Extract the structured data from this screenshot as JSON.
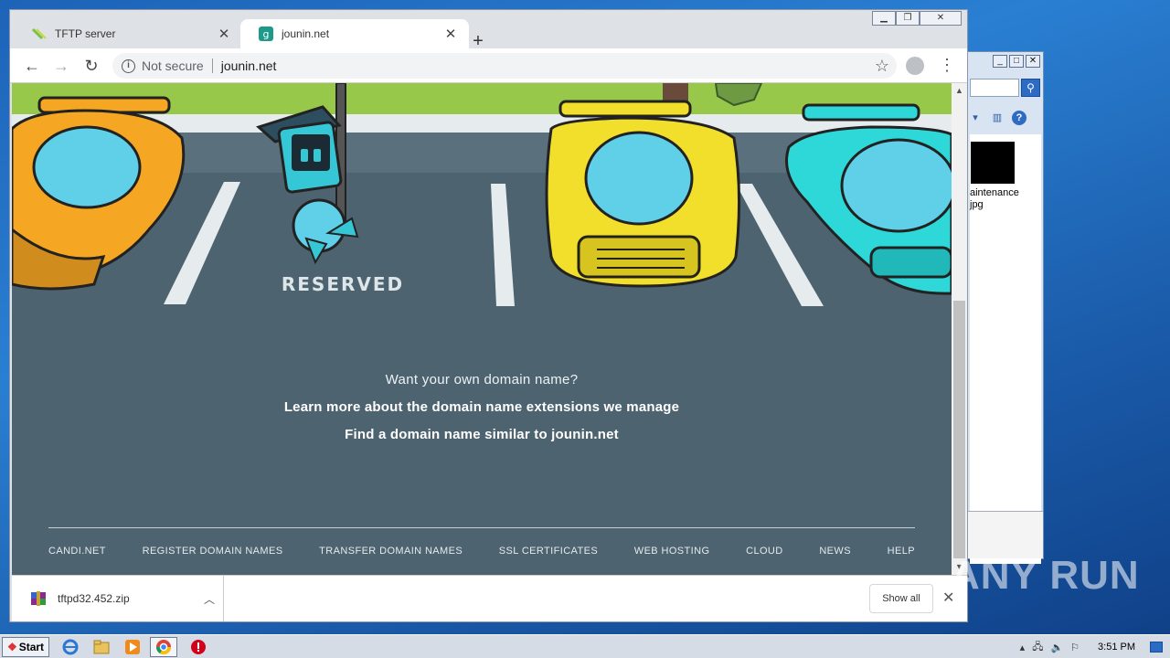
{
  "desktop": {
    "explorer": {
      "thumbnail_label": "aintenance\njpg"
    }
  },
  "browser": {
    "tabs": [
      {
        "title": "TFTP server",
        "active": false
      },
      {
        "title": "jounin.net",
        "active": true
      }
    ],
    "new_tab_symbol": "+",
    "omnibox": {
      "security_label": "Not secure",
      "url": "jounin.net"
    },
    "page": {
      "reserved_sign": "RESERVED",
      "tagline": "Want your own domain name?",
      "link_extensions": "Learn more about the domain name extensions we manage",
      "link_similar": "Find a domain name similar to jounin.net",
      "footer": [
        "CANDI.NET",
        "REGISTER DOMAIN NAMES",
        "TRANSFER DOMAIN NAMES",
        "SSL CERTIFICATES",
        "WEB HOSTING",
        "CLOUD",
        "NEWS",
        "HELP"
      ]
    },
    "download_bar": {
      "file_name": "tftpd32.452.zip",
      "show_all": "Show all"
    }
  },
  "taskbar": {
    "start_label": "Start",
    "clock": "3:51 PM"
  },
  "watermark": "ANY RUN",
  "colors": {
    "page_bg": "#4d6370",
    "grass": "#97c84a",
    "car_orange": "#f5a623",
    "car_yellow": "#f2df2b",
    "car_cyan": "#2ed8d8"
  }
}
